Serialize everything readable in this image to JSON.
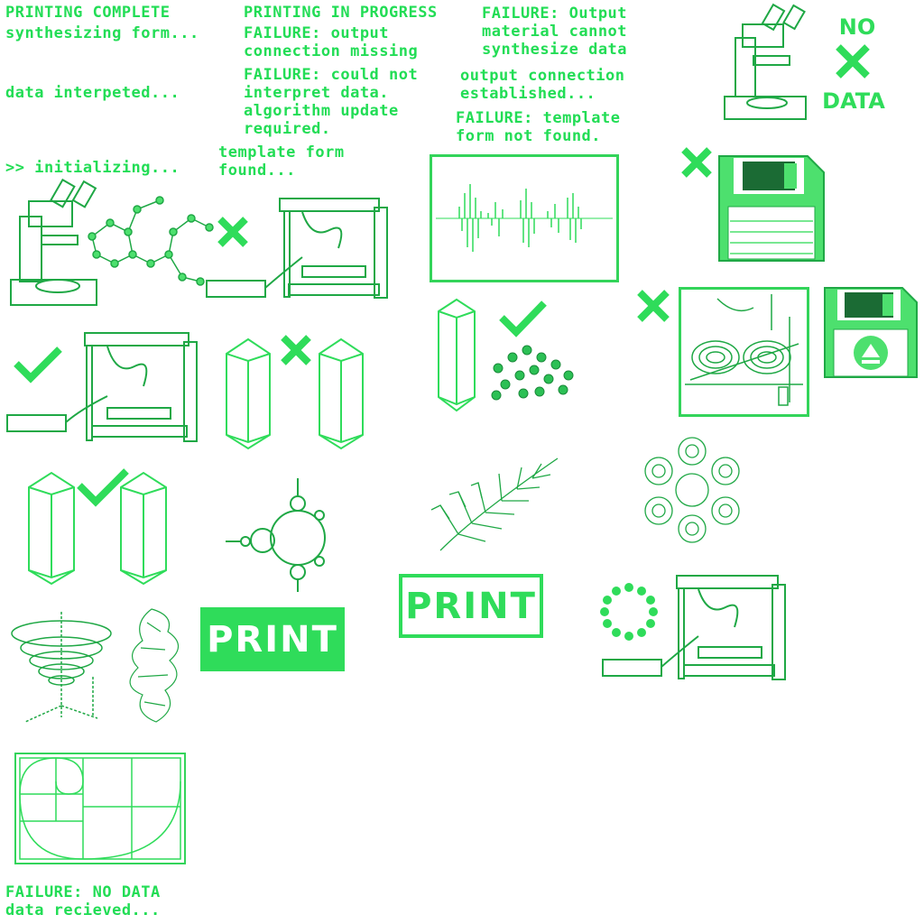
{
  "status": {
    "printing_complete": "PRINTING COMPLETE",
    "synthesizing": "synthesizing form...",
    "data_interpreted": "data interpeted...",
    "initializing": ">> initializing...",
    "printing_in_progress": "PRINTING IN PROGRESS",
    "failure_output_missing": "FAILURE: output\nconnection missing",
    "failure_interpret": "FAILURE: could not\ninterpret data.\nalgorithm update\nrequired.",
    "template_found": "template form\nfound...",
    "failure_material": "FAILURE: Output\nmaterial cannot\nsynthesize data",
    "output_established": "output connection\nestablished...",
    "failure_template": "FAILURE: template\nform not found.",
    "failure_no_data": "FAILURE: NO DATA\ndata recieved..."
  },
  "badges": {
    "no": "NO",
    "data": "DATA"
  },
  "buttons": {
    "print_filled": "PRINT",
    "print_outline": "PRINT"
  },
  "icons": {
    "microscope": "microscope-icon",
    "printer": "3d-printer-icon",
    "check": "check-icon",
    "cross": "cross-icon",
    "floppy": "floppy-disk-icon",
    "crystal": "crystal-icon",
    "molecule": "molecule-icon",
    "waveform": "waveform-icon",
    "fractal": "fractal-icon",
    "spinner": "loading-spinner-icon"
  },
  "colors": {
    "accent": "#2fdc5a",
    "dark": "#1a8a3a",
    "background": "#ffffff"
  }
}
